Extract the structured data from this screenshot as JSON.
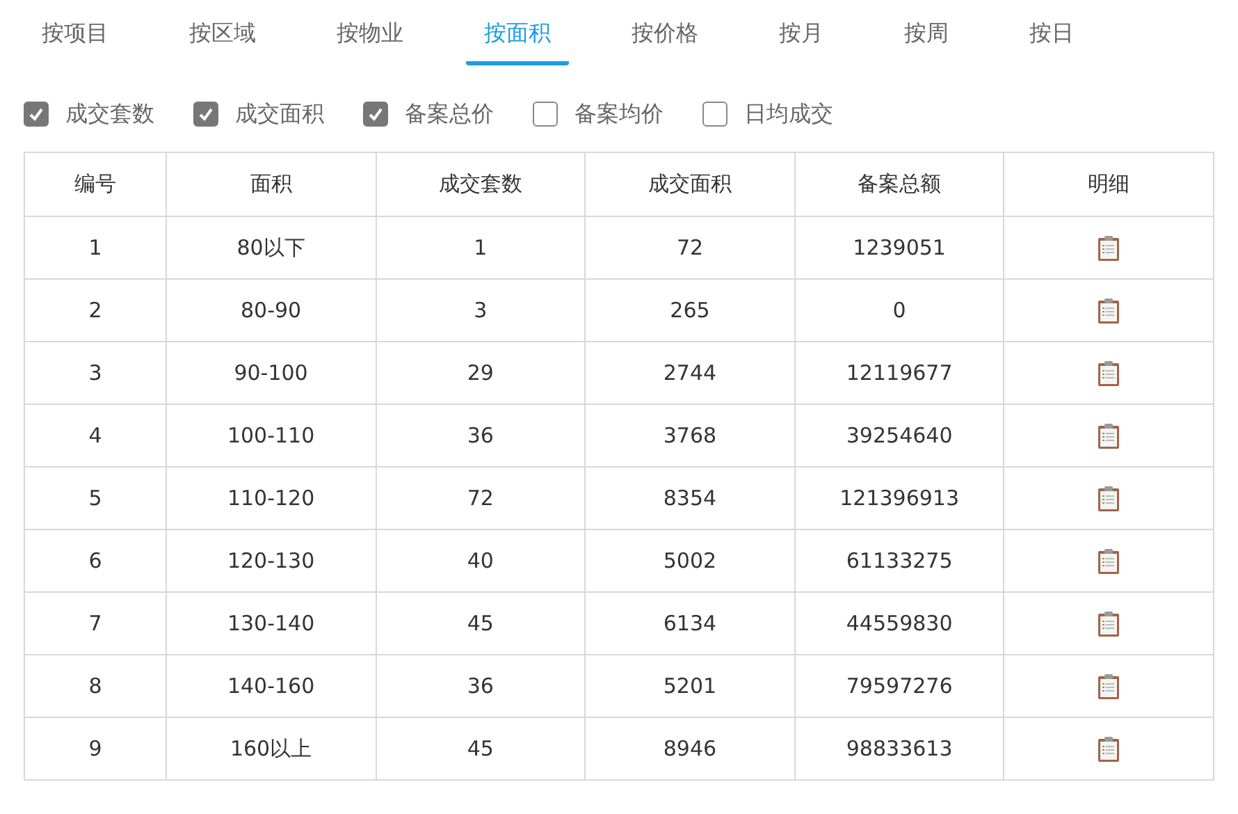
{
  "tabs": [
    {
      "label": "按项目",
      "selected": false
    },
    {
      "label": "按区域",
      "selected": false
    },
    {
      "label": "按物业",
      "selected": false
    },
    {
      "label": "按面积",
      "selected": true
    },
    {
      "label": "按价格",
      "selected": false
    },
    {
      "label": "按月",
      "selected": false
    },
    {
      "label": "按周",
      "selected": false
    },
    {
      "label": "按日",
      "selected": false
    }
  ],
  "options": [
    {
      "label": "成交套数",
      "checked": true
    },
    {
      "label": "成交面积",
      "checked": true
    },
    {
      "label": "备案总价",
      "checked": true
    },
    {
      "label": "备案均价",
      "checked": false
    },
    {
      "label": "日均成交",
      "checked": false
    }
  ],
  "table": {
    "columns": [
      "编号",
      "面积",
      "成交套数",
      "成交面积",
      "备案总额",
      "明细"
    ],
    "rows": [
      [
        "1",
        "80以下",
        "1",
        "72",
        "1239051"
      ],
      [
        "2",
        "80-90",
        "3",
        "265",
        "0"
      ],
      [
        "3",
        "90-100",
        "29",
        "2744",
        "12119677"
      ],
      [
        "4",
        "100-110",
        "36",
        "3768",
        "39254640"
      ],
      [
        "5",
        "110-120",
        "72",
        "8354",
        "121396913"
      ],
      [
        "6",
        "120-130",
        "40",
        "5002",
        "61133275"
      ],
      [
        "7",
        "130-140",
        "45",
        "6134",
        "44559830"
      ],
      [
        "8",
        "140-160",
        "36",
        "5201",
        "79597276"
      ],
      [
        "9",
        "160以上",
        "45",
        "8946",
        "98833613"
      ]
    ]
  }
}
